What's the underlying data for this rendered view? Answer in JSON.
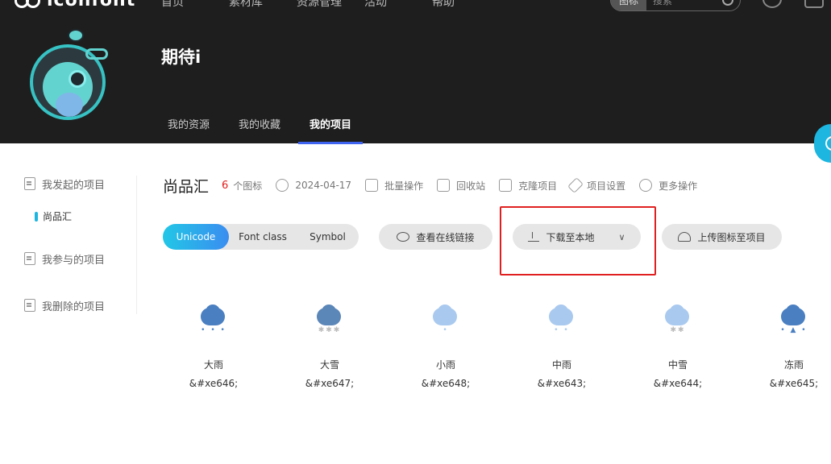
{
  "brand": {
    "logo_text": "iconfont"
  },
  "topnav": {
    "items": [
      "首页",
      "素材库",
      "资源管理",
      "活动",
      "帮助"
    ]
  },
  "search": {
    "scope": "图标",
    "placeholder": "搜索"
  },
  "profile": {
    "username": "期待i"
  },
  "tabs": [
    {
      "label": "我的资源",
      "active": false
    },
    {
      "label": "我的收藏",
      "active": false
    },
    {
      "label": "我的项目",
      "active": true
    }
  ],
  "sidebar": {
    "items": [
      "我发起的项目",
      "我参与的项目",
      "我删除的项目"
    ],
    "sub_item": "尚品汇"
  },
  "project": {
    "name": "尚品汇",
    "count": "6",
    "count_label": "个图标",
    "date": "2024-04-17",
    "actions": [
      "批量操作",
      "回收站",
      "克隆项目",
      "项目设置",
      "更多操作"
    ]
  },
  "toolbar": {
    "modes": [
      "Unicode",
      "Font class",
      "Symbol"
    ],
    "active_mode": "Unicode",
    "online_link": "查看在线链接",
    "download": "下载至本地",
    "upload": "上传图标至项目"
  },
  "icons": [
    {
      "name": "大雨",
      "code": "&#xe646;",
      "color": "#4a7fc1",
      "drops": "• • •"
    },
    {
      "name": "大雪",
      "code": "&#xe647;",
      "color": "#5b86b8",
      "drops": "✱✱✱"
    },
    {
      "name": "小雨",
      "code": "&#xe648;",
      "color": "#a9c9ef",
      "drops": "•"
    },
    {
      "name": "中雨",
      "code": "&#xe643;",
      "color": "#a9c9ef",
      "drops": "• •"
    },
    {
      "name": "中雪",
      "code": "&#xe644;",
      "color": "#a9c9ef",
      "drops": "✱✱"
    },
    {
      "name": "冻雨",
      "code": "&#xe645;",
      "color": "#4a7fc1",
      "drops": "• ▲ •"
    }
  ],
  "colors": {
    "accent": "#1cb6e0",
    "highlight": "#e02020",
    "tab_underline": "#3e64f0"
  }
}
